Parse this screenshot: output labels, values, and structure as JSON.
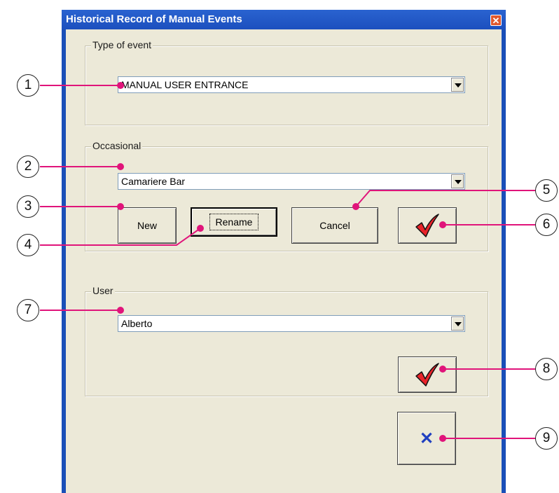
{
  "window": {
    "title": "Historical Record of Manual Events",
    "close_label": "✕"
  },
  "type_group": {
    "legend": "Type of event",
    "combo_value": "MANUAL USER ENTRANCE"
  },
  "occasional_group": {
    "legend": "Occasional",
    "combo_value": "Camariere Bar",
    "new_label": "New",
    "rename_label": "Rename",
    "cancel_label": "Cancel",
    "confirm_icon": "red-checkmark-icon"
  },
  "user_group": {
    "legend": "User",
    "combo_value": "Alberto",
    "confirm_icon": "red-checkmark-icon"
  },
  "close_button": {
    "icon": "blue-x-icon",
    "glyph": "✕"
  },
  "callouts": [
    "1",
    "2",
    "3",
    "4",
    "5",
    "6",
    "7",
    "8",
    "9"
  ],
  "colors": {
    "accent_line": "#e0147a",
    "check_red": "#e8232a",
    "x_blue": "#2040c0",
    "titlebar": "#1c4fbe"
  }
}
